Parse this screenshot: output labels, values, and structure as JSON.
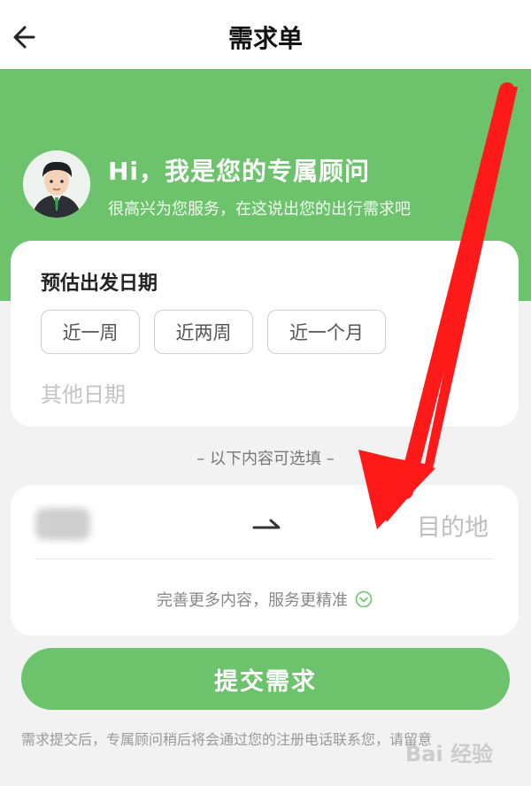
{
  "header": {
    "title": "需求单",
    "back_icon": "back-arrow-icon"
  },
  "advisor": {
    "greeting": "Hi，我是您的专属顾问",
    "subtext": "很高兴为您服务，在这说出您的出行需求吧",
    "avatar_icon": "advisor-avatar"
  },
  "date_section": {
    "title": "预估出发日期",
    "options": [
      "近一周",
      "近两周",
      "近一个月"
    ],
    "other_placeholder": "其他日期"
  },
  "optional_note": "– 以下内容可选填 –",
  "route": {
    "origin_value": "",
    "swap_icon": "swap-arrow-icon",
    "destination_placeholder": "目的地",
    "more_content": "完善更多内容，服务更精准",
    "expand_icon": "chevron-down-circle-icon"
  },
  "submit": {
    "label": "提交需求"
  },
  "footer": {
    "text": "需求提交后，专属顾问稍后将会通过您的注册电话联系您，请留意",
    "watermark": "Bai 经验"
  },
  "colors": {
    "accent": "#6cc36b",
    "annotation_arrow": "#ff1a1a"
  }
}
